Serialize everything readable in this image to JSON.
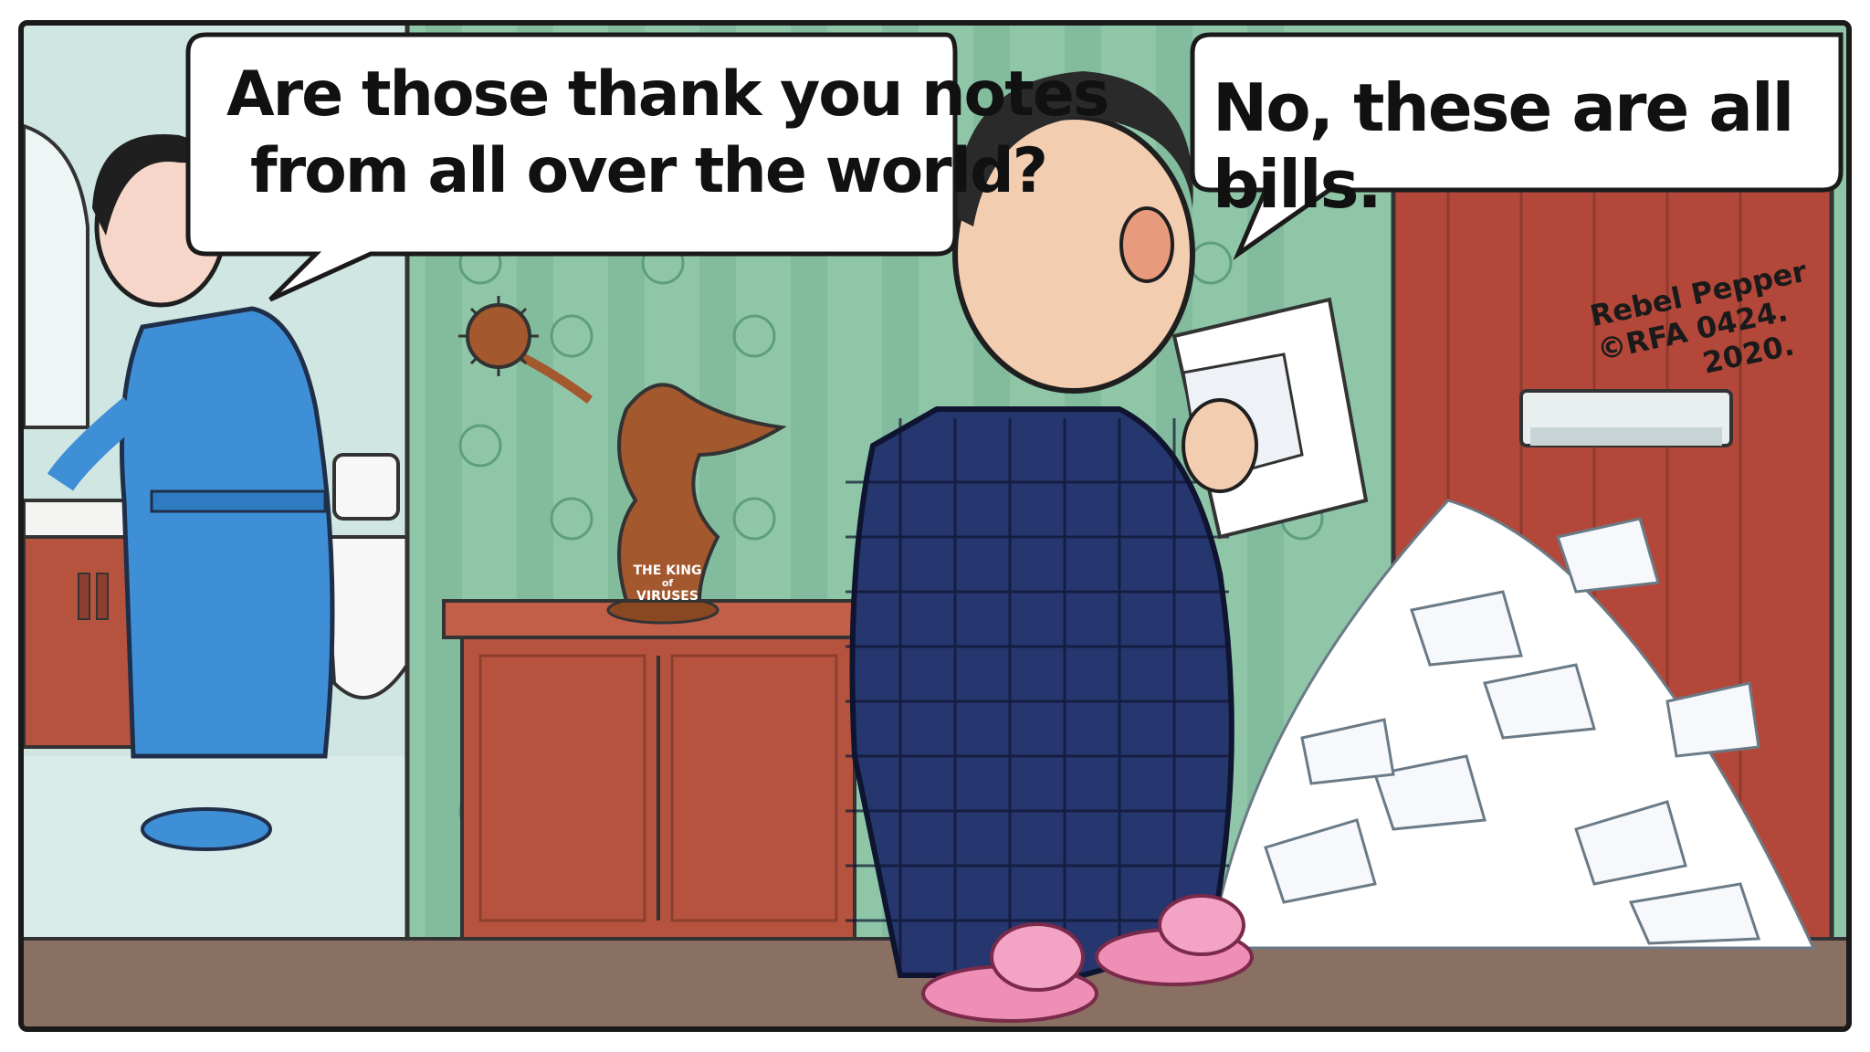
{
  "caption": {
    "wife_line_1": "Are those thank you notes",
    "wife_line_2": "from all over the world?",
    "husband_line": "No, these are all bills."
  },
  "statue_plaque": {
    "line_1": "THE KING",
    "line_2": "of",
    "line_3": "VIRUSES"
  },
  "signature": {
    "artist_line_1": "Rebel Pepper",
    "artist_line_2": "©RFA 0424.",
    "artist_line_3": "2020."
  },
  "colors": {
    "wall_wallpaper": "#8fc6a8",
    "bathroom_wall": "#cfe6e2",
    "cabinet": "#b5533f",
    "door": "#b3483a",
    "floor": "#8a6f63",
    "robe": "#3f8fd6",
    "pajamas": "#26366e",
    "slippers": "#ef8fb6",
    "statue": "#a3582e"
  }
}
